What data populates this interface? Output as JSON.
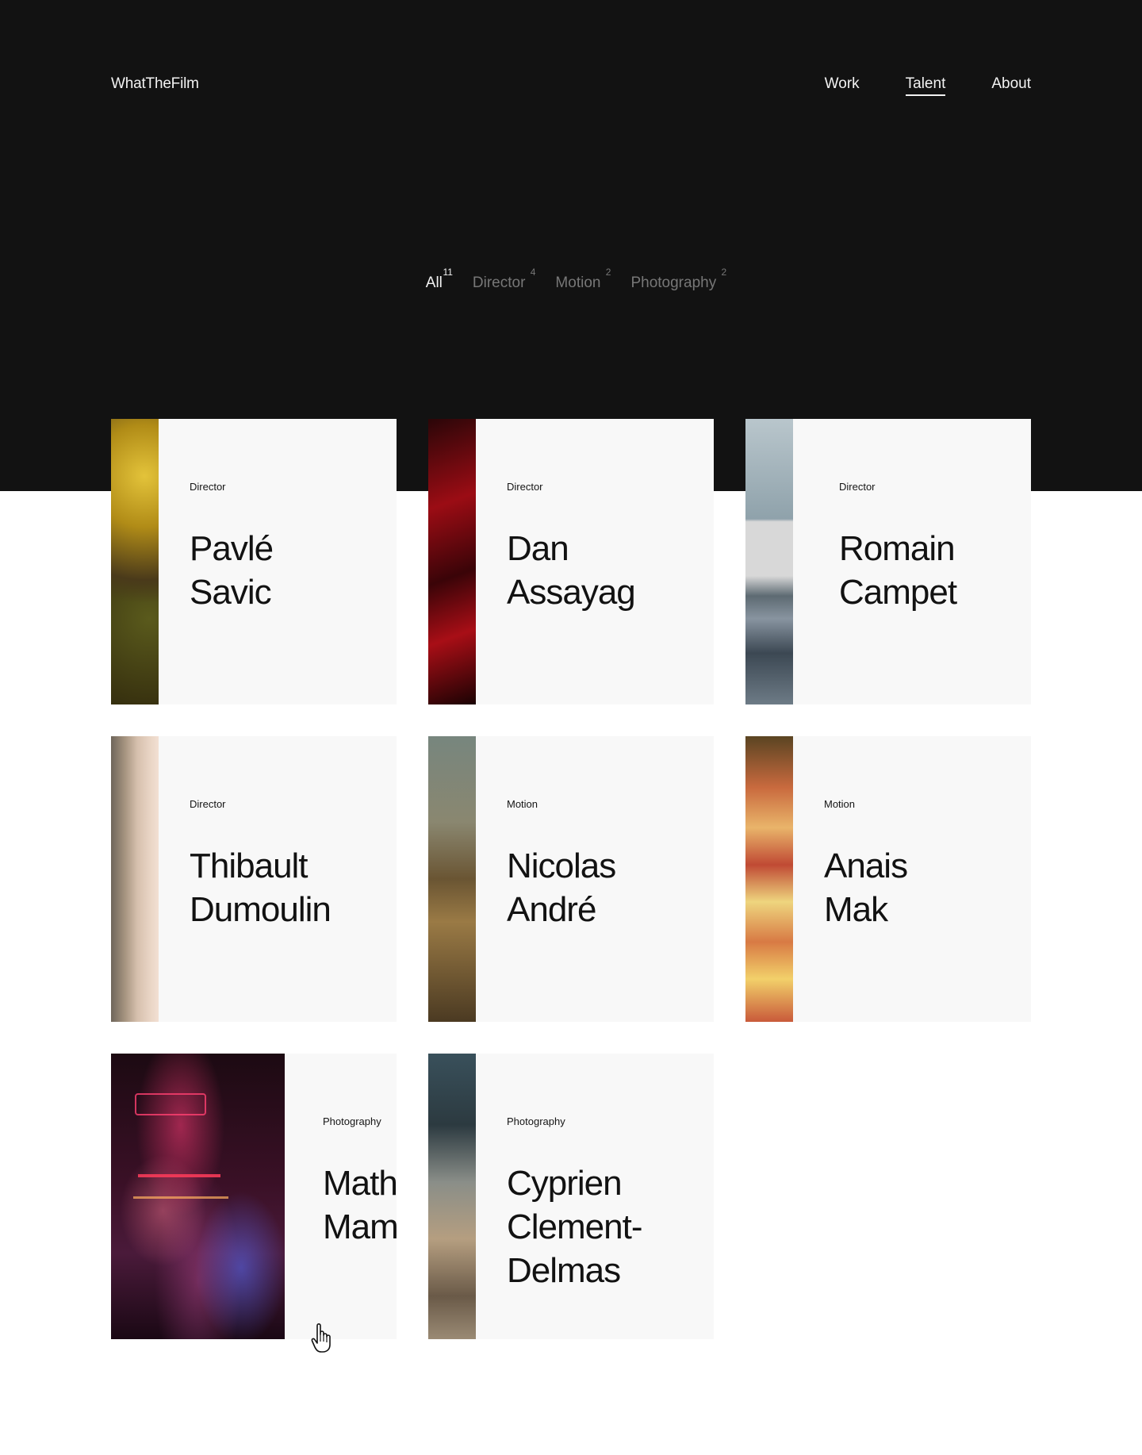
{
  "header": {
    "brand": "WhatTheFilm",
    "nav": [
      {
        "label": "Work",
        "active": false
      },
      {
        "label": "Talent",
        "active": true
      },
      {
        "label": "About",
        "active": false
      }
    ]
  },
  "filters": [
    {
      "label": "All",
      "count": "11",
      "active": true
    },
    {
      "label": "Director",
      "count": "4",
      "active": false
    },
    {
      "label": "Motion",
      "count": "2",
      "active": false
    },
    {
      "label": "Photography",
      "count": "2",
      "active": false
    }
  ],
  "cards": [
    {
      "role": "Director",
      "first": "Pavlé",
      "last": "Savic",
      "image": "golden-foliage-photo"
    },
    {
      "role": "Director",
      "first": "Dan",
      "last": "Assayag",
      "image": "red-fabric-photo"
    },
    {
      "role": "Director",
      "first": "Romain",
      "last": "Campet",
      "image": "snowy-landscape-photo"
    },
    {
      "role": "Director",
      "first": "Thibault",
      "last": "Dumoulin",
      "image": "woman-portrait-photo"
    },
    {
      "role": "Motion",
      "first": "Nicolas",
      "last": "André",
      "image": "child-desert-photo"
    },
    {
      "role": "Motion",
      "first": "Anais",
      "last": "Mak",
      "image": "fruit-pieces-photo"
    },
    {
      "role": "Photography",
      "first": "Math",
      "last": "Mam",
      "image": "neon-night-street-photo"
    },
    {
      "role": "Photography",
      "first": "Cyprien",
      "last": "Clement-",
      "extra": "Delmas",
      "image": "man-sitting-photo"
    }
  ],
  "colors": {
    "hero_bg": "#121212",
    "card_bg": "#f8f8f8",
    "text_light": "#f2f2f2",
    "text_muted": "#777777",
    "text_dark": "#121212"
  }
}
